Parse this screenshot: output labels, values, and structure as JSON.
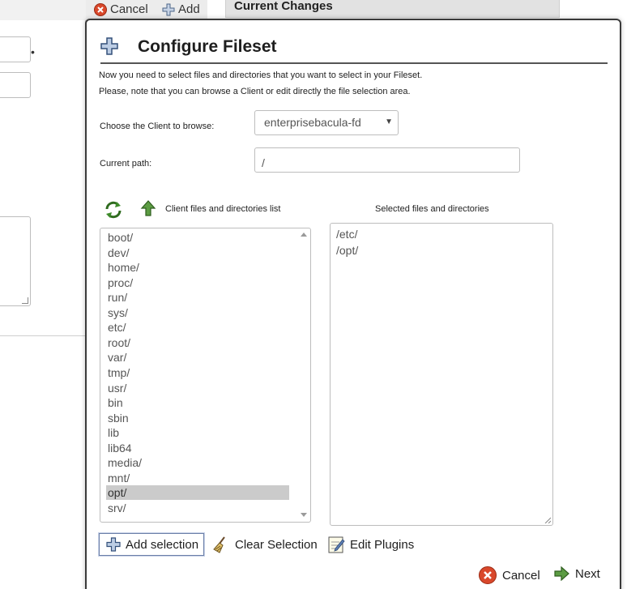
{
  "background": {
    "toolbar": {
      "cancel_label": "Cancel",
      "add_label": "Add"
    },
    "panel_title": "Current Changes"
  },
  "dialog": {
    "title": "Configure Fileset",
    "intro_line1": "Now you need to select files and directories that you want to select in your Fileset.",
    "intro_line2": "Please, note that you can browse a Client or edit directly the file selection area.",
    "client_label": "Choose the Client to browse:",
    "client_value": "enterprisebacula-fd",
    "path_label": "Current path:",
    "path_value": "/",
    "list_caption": "Client files and directories list",
    "selected_caption": "Selected files and directories",
    "files": [
      "boot/",
      "dev/",
      "home/",
      "proc/",
      "run/",
      "sys/",
      "etc/",
      "root/",
      "var/",
      "tmp/",
      "usr/",
      "bin",
      "sbin",
      "lib",
      "lib64",
      "media/",
      "mnt/",
      "opt/",
      "srv/"
    ],
    "highlighted_file": "opt/",
    "selected": [
      "/etc/",
      "/opt/"
    ],
    "buttons": {
      "add_selection": "Add selection",
      "clear_selection": "Clear Selection",
      "edit_plugins": "Edit Plugins",
      "cancel": "Cancel",
      "next": "Next"
    }
  },
  "icons": {
    "title": "plus-icon",
    "refresh": "refresh-icon",
    "up": "up-arrow-icon",
    "cancel": "cancel-icon",
    "next": "next-arrow-icon",
    "clear": "broom-icon",
    "plugins": "edit-icon"
  },
  "colors": {
    "selected_row": "#cbcbcb",
    "cancel_red": "#d9482b",
    "arrow_green": "#4f8a3a"
  }
}
